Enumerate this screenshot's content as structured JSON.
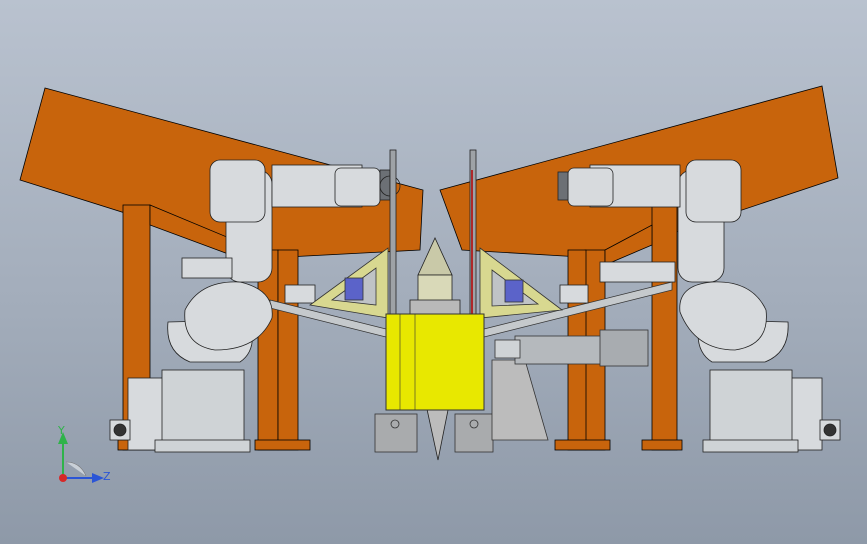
{
  "triad": {
    "y_label": "Y",
    "z_label": "Z",
    "y_color": "#2fb34a",
    "z_color": "#2b55d6",
    "origin_color": "#d62828"
  },
  "colors": {
    "frame": "#c8640c",
    "frame_shadow": "#8c4206",
    "robot": "#d7dadd",
    "robot_dark": "#6c7075",
    "base": "#cfd3d6",
    "yellow": "#e8e800",
    "yellow_frame": "#d8d890",
    "gray_block": "#a9abad",
    "blue": "#5b63c9"
  }
}
